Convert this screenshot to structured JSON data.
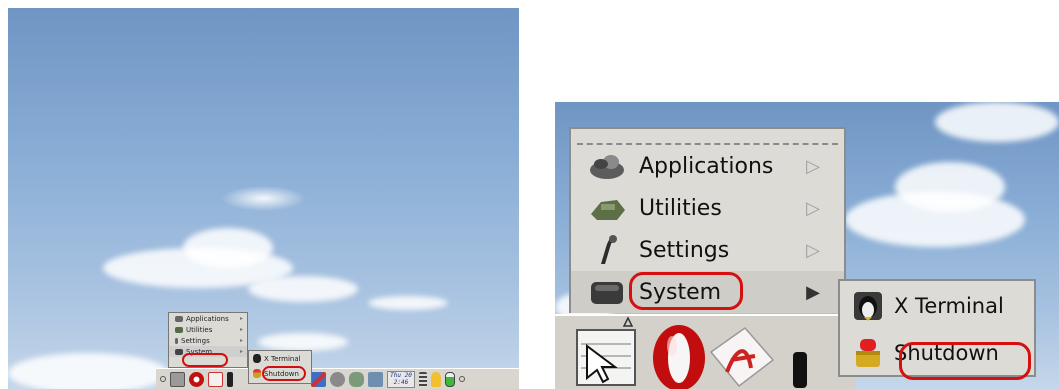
{
  "left_screenshot": {
    "menu": {
      "items": [
        {
          "label": "Applications",
          "icon": "applications-icon",
          "has_submenu": true
        },
        {
          "label": "Utilities",
          "icon": "utilities-icon",
          "has_submenu": true
        },
        {
          "label": "Settings",
          "icon": "settings-icon",
          "has_submenu": true
        },
        {
          "label": "System",
          "icon": "system-icon",
          "has_submenu": true
        }
      ]
    },
    "submenu": {
      "items": [
        {
          "label": "X Terminal",
          "icon": "terminal-icon"
        },
        {
          "label": "Shutdown",
          "icon": "shutdown-icon"
        }
      ]
    },
    "clock": {
      "day": "Thu 20",
      "time": "2:46"
    }
  },
  "right_screenshot": {
    "menu": {
      "items": [
        {
          "label": "Applications",
          "icon": "applications-icon",
          "has_submenu": true
        },
        {
          "label": "Utilities",
          "icon": "utilities-icon",
          "has_submenu": true
        },
        {
          "label": "Settings",
          "icon": "settings-icon",
          "has_submenu": true
        },
        {
          "label": "System",
          "icon": "system-icon",
          "has_submenu": true
        }
      ]
    },
    "submenu": {
      "items": [
        {
          "label": "X Terminal",
          "icon": "terminal-icon"
        },
        {
          "label": "Shutdown",
          "icon": "shutdown-icon"
        }
      ]
    }
  },
  "colors": {
    "highlight_ring": "#d61010",
    "menu_bg": "#dddbd6",
    "sky_top": "#6f95c3"
  }
}
